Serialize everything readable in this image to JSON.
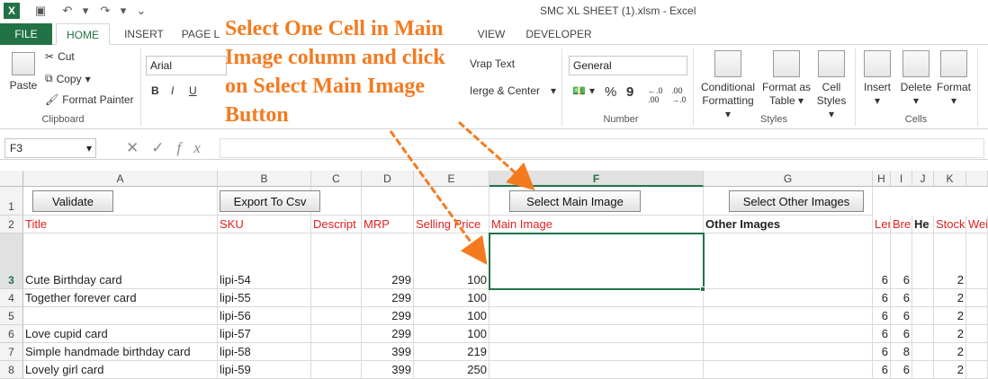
{
  "titlebar": {
    "title": "SMC XL SHEET (1).xlsm - Excel"
  },
  "tabs": [
    "FILE",
    "HOME",
    "INSERT",
    "PAGE L",
    "VIEW",
    "DEVELOPER"
  ],
  "clipboard": {
    "cut": "Cut",
    "copy": "Copy",
    "format_painter": "Format Painter",
    "paste": "Paste",
    "label": "Clipboard"
  },
  "font": {
    "name": "Arial",
    "bold": "B",
    "italic": "I",
    "underline": "U"
  },
  "alignment": {
    "wrap_text": "Vrap Text",
    "merge_center": "Ierge & Center"
  },
  "number": {
    "format": "General",
    "percent": "%",
    "comma": "9",
    "label": "Number"
  },
  "styles": {
    "conditional": [
      "Conditional",
      "Formatting"
    ],
    "format_table": [
      "Format as",
      "Table"
    ],
    "cell_styles": [
      "Cell",
      "Styles"
    ],
    "label": "Styles"
  },
  "cells": {
    "insert": "Insert",
    "delete": "Delete",
    "format": "Format",
    "label": "Cells"
  },
  "formula_bar": {
    "name_box": "F3",
    "fx": "fx"
  },
  "annotation": "Select One Cell in Main Image column and click on Select Main Image Button",
  "columns": [
    "A",
    "B",
    "C",
    "D",
    "E",
    "F",
    "G",
    "H",
    "I",
    "J",
    "K"
  ],
  "buttons": {
    "validate": "Validate",
    "export": "Export To Csv",
    "select_main": "Select Main Image",
    "select_other": "Select Other Images"
  },
  "headers": {
    "title": "Title",
    "sku": "SKU",
    "descript": "Descript",
    "mrp": "MRP",
    "selling_price": "Selling Price",
    "main_image": "Main Image",
    "other_images": "Other Images",
    "len": "Ler",
    "bre": "Bre",
    "he": "He",
    "stock": "Stock",
    "wei": "Wei"
  },
  "rows": [
    {
      "num": "3",
      "title": "Cute Birthday card",
      "sku": "lipi-54",
      "mrp": "299",
      "price": "100",
      "h": "6",
      "i": "6",
      "k": "2"
    },
    {
      "num": "4",
      "title": "Together forever card",
      "sku": "lipi-55",
      "mrp": "299",
      "price": "100",
      "h": "6",
      "i": "6",
      "k": "2"
    },
    {
      "num": "5",
      "title": "",
      "sku": "lipi-56",
      "mrp": "299",
      "price": "100",
      "h": "6",
      "i": "6",
      "k": "2"
    },
    {
      "num": "6",
      "title": "Love cupid card",
      "sku": "lipi-57",
      "mrp": "299",
      "price": "100",
      "h": "6",
      "i": "6",
      "k": "2"
    },
    {
      "num": "7",
      "title": "Simple handmade birthday card",
      "sku": "lipi-58",
      "mrp": "399",
      "price": "219",
      "h": "6",
      "i": "8",
      "k": "2"
    },
    {
      "num": "8",
      "title": "Lovely girl card",
      "sku": "lipi-59",
      "mrp": "399",
      "price": "250",
      "h": "6",
      "i": "6",
      "k": "2"
    }
  ],
  "colors": {
    "accent": "#217346",
    "header_red": "#e02020",
    "annotation": "#f47a20"
  }
}
